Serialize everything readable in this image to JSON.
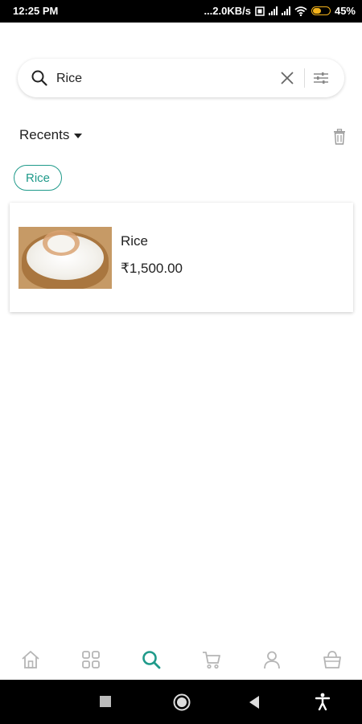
{
  "status_bar": {
    "time": "12:25 PM",
    "network_speed": "...2.0KB/s",
    "battery": "45%",
    "battery_level": 0.45
  },
  "search": {
    "value": "Rice",
    "placeholder": ""
  },
  "recents": {
    "label": "Recents",
    "chips": [
      "Rice"
    ]
  },
  "results": [
    {
      "name": "Rice",
      "price": "₹1,500.00"
    }
  ],
  "bottom_nav": {
    "items": [
      "home-icon",
      "grid-icon",
      "search-icon",
      "cart-icon",
      "profile-icon",
      "basket-icon"
    ],
    "active_index": 2
  },
  "colors": {
    "accent": "#1f9a8a",
    "inactive_icon": "#b5b5b5",
    "status_bar_bg": "#000000",
    "battery": "#f3b21b"
  }
}
